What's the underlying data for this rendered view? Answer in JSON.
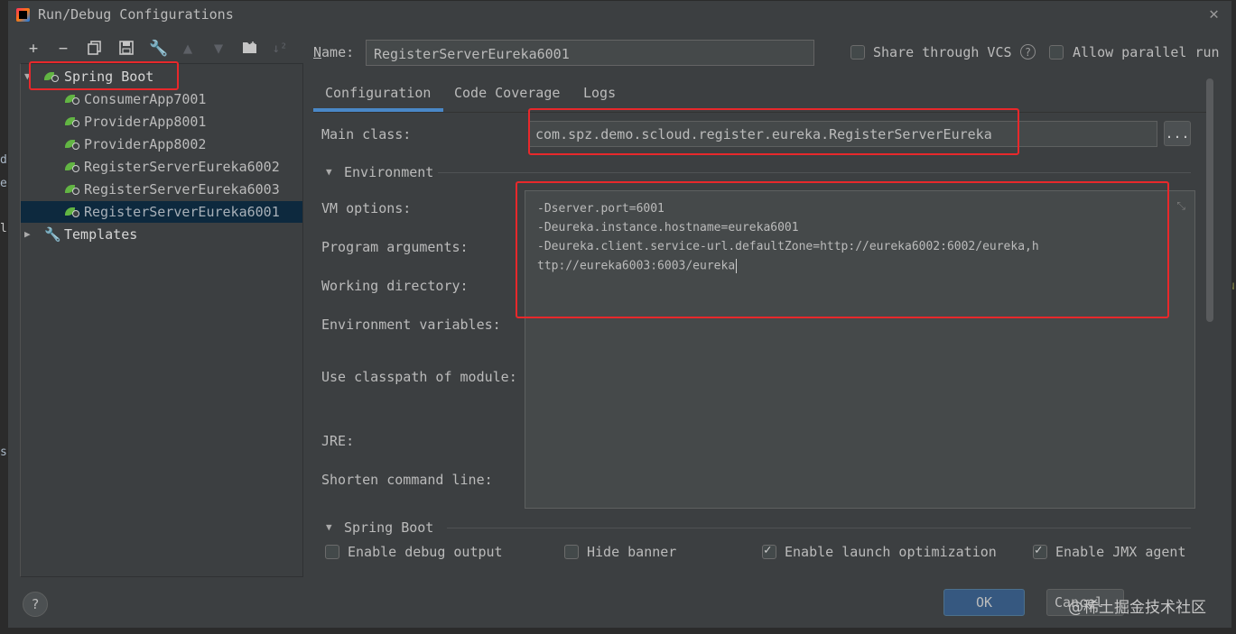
{
  "window": {
    "title": "Run/Debug Configurations"
  },
  "toolbar": {
    "add_icon": "plus-icon",
    "remove_icon": "minus-icon",
    "copy_icon": "copy-icon",
    "save_icon": "save-icon",
    "edit_icon": "wrench-icon",
    "move_up_icon": "arrow-up-icon",
    "move_down_icon": "arrow-down-icon",
    "folder_icon": "folder-icon",
    "sort_icon": "sort-icon"
  },
  "tree": {
    "group_label": "Spring Boot",
    "items": [
      "ConsumerApp7001",
      "ProviderApp8001",
      "ProviderApp8002",
      "RegisterServerEureka6002",
      "RegisterServerEureka6003",
      "RegisterServerEureka6001"
    ],
    "selected_index": 5,
    "templates_label": "Templates"
  },
  "header": {
    "name_label": "Name:",
    "name_value": "RegisterServerEureka6001",
    "share_vcs_label": "Share through VCS",
    "share_vcs_checked": false,
    "allow_parallel_label": "Allow parallel run",
    "allow_parallel_checked": false
  },
  "tabs": [
    "Configuration",
    "Code Coverage",
    "Logs"
  ],
  "active_tab": "Configuration",
  "config": {
    "main_class_label": "Main class:",
    "main_class_value": "com.spz.demo.scloud.register.eureka.RegisterServerEureka",
    "browse_label": "...",
    "environment_section": "Environment",
    "vm_options_label": "VM options:",
    "program_args_label": "Program arguments:",
    "working_dir_label": "Working directory:",
    "env_vars_label": "Environment variables:",
    "classpath_label": "Use classpath of module:",
    "jre_label": "JRE:",
    "shorten_label": "Shorten command line:",
    "vm_lines": [
      "-Dserver.port=6001",
      "-Deureka.instance.hostname=eureka6001",
      "-Deureka.client.service-url.defaultZone=http://eureka6002:6002/eureka,h",
      "ttp://eureka6003:6003/eureka"
    ],
    "spring_boot_section": "Spring Boot",
    "enable_debug_label": "Enable debug output",
    "enable_debug_checked": false,
    "hide_banner_label": "Hide banner",
    "hide_banner_checked": false,
    "launch_opt_label": "Enable launch optimization",
    "launch_opt_checked": true,
    "jmx_label": "Enable JMX agent",
    "jmx_checked": true
  },
  "footer": {
    "help_label": "?",
    "ok_label": "OK",
    "cancel_label": "Cancel",
    "watermark": "@稀土掘金技术社区"
  },
  "colors": {
    "dialog_bg": "#3c3f41",
    "selection_bg": "#0d293e",
    "accent_tab": "#4a88c7",
    "ok_button": "#365880",
    "highlight_box": "#e8282b",
    "spring_leaf": "#62b543"
  }
}
